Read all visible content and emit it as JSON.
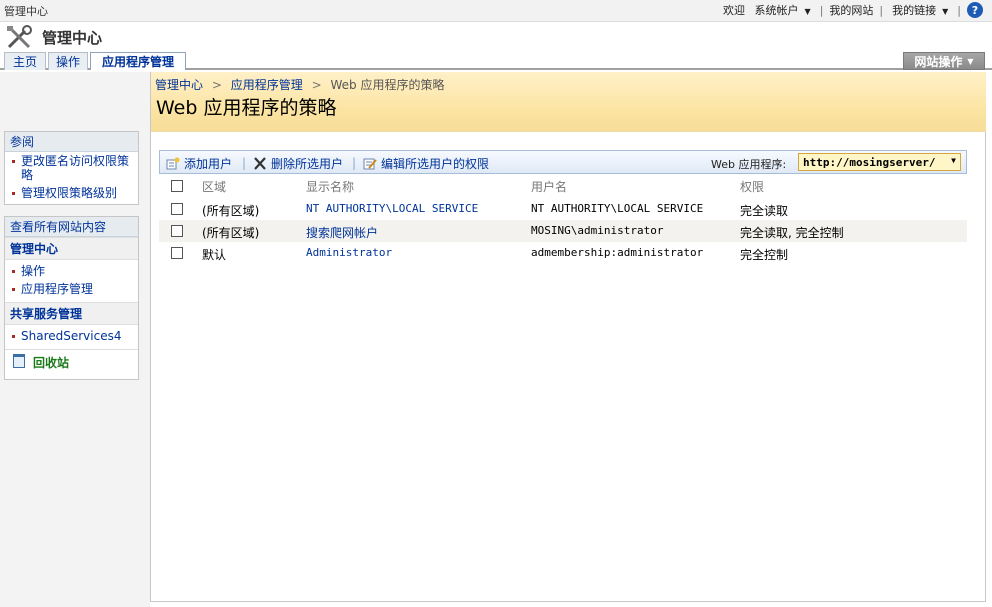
{
  "topbar": {
    "site_name": "管理中心",
    "welcome": "欢迎",
    "account": "系统帐户",
    "my_site": "我的网站",
    "my_links": "我的链接",
    "help_glyph": "?"
  },
  "header": {
    "title": "管理中心",
    "tabs": [
      {
        "label": "主页",
        "active": false
      },
      {
        "label": "操作",
        "active": false
      },
      {
        "label": "应用程序管理",
        "active": true
      }
    ],
    "site_actions": "网站操作"
  },
  "sidebar": {
    "see_also_title": "参阅",
    "see_also_items": [
      "更改匿名访问权限策略",
      "管理权限策略级别"
    ],
    "view_all": "查看所有网站内容",
    "section1_title": "管理中心",
    "section1_items": [
      "操作",
      "应用程序管理"
    ],
    "section2_title": "共享服务管理",
    "section2_items": [
      "SharedServices4"
    ],
    "recycle_bin": "回收站"
  },
  "main": {
    "breadcrumb": [
      "管理中心",
      "应用程序管理",
      "Web 应用程序的策略"
    ],
    "breadcrumb_sep": ">",
    "page_title": "Web 应用程序的策略",
    "toolbar": {
      "add_users": "添加用户",
      "delete_users": "删除所选用户",
      "edit_permissions": "编辑所选用户的权限",
      "separator": "|",
      "web_app_label": "Web 应用程序:",
      "web_app_value": "http://mosingserver/"
    },
    "table": {
      "columns": [
        "区域",
        "显示名称",
        "用户名",
        "权限"
      ],
      "rows": [
        {
          "zone": "(所有区域)",
          "display_name": "NT AUTHORITY\\LOCAL SERVICE",
          "user_name": "NT AUTHORITY\\LOCAL SERVICE",
          "permissions": "完全读取"
        },
        {
          "zone": "(所有区域)",
          "display_name": "搜索爬网帐户",
          "user_name": "MOSING\\administrator",
          "permissions": "完全读取, 完全控制"
        },
        {
          "zone": "默认",
          "display_name": "Administrator",
          "user_name": "admembership:administrator",
          "permissions": "完全控制"
        }
      ]
    }
  },
  "colors": {
    "link": "#003399",
    "banner": "#fbe3a0",
    "nav_bullet": "#a52a2a",
    "recycle": "#1a7a1a"
  },
  "icons": [
    "tools-icon",
    "help-icon",
    "add-user-icon",
    "delete-icon",
    "edit-icon",
    "recycle-bin-icon",
    "chevron-down-icon"
  ]
}
